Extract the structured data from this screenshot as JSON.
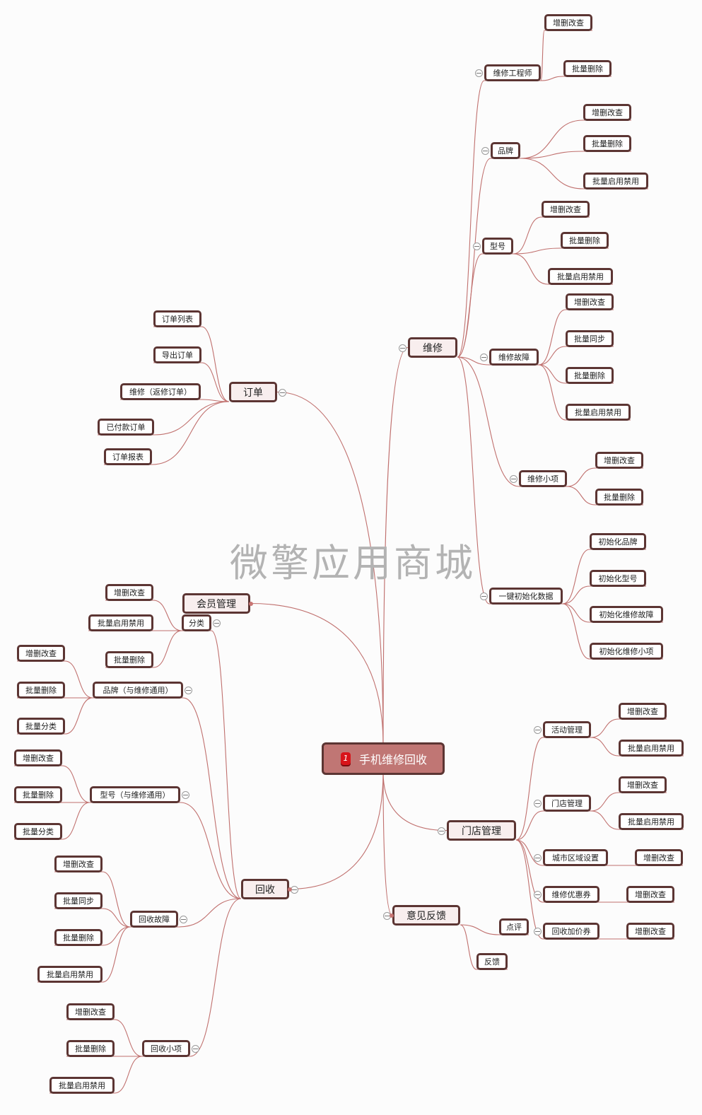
{
  "watermark": "微擎应用商城",
  "colors": {
    "link": "#c0706e",
    "border": "#5c3533",
    "root_fill": "#c07674",
    "l1_fill": "#f8eeee",
    "badge": "#d8141a"
  },
  "root": {
    "id": "root",
    "label": "手机维修回收",
    "badge": "1"
  },
  "nodes": [
    {
      "id": "weixiu",
      "label": "维修",
      "parent": "root",
      "level": 1
    },
    {
      "id": "wx_gcs",
      "label": "维修工程师",
      "parent": "weixiu",
      "level": 2
    },
    {
      "id": "wx_gcs_1",
      "label": "增删改查",
      "parent": "wx_gcs",
      "level": 3
    },
    {
      "id": "wx_gcs_2",
      "label": "批量删除",
      "parent": "wx_gcs",
      "level": 3
    },
    {
      "id": "wx_pp",
      "label": "品牌",
      "parent": "weixiu",
      "level": 2
    },
    {
      "id": "wx_pp_1",
      "label": "增删改查",
      "parent": "wx_pp",
      "level": 3
    },
    {
      "id": "wx_pp_2",
      "label": "批量删除",
      "parent": "wx_pp",
      "level": 3
    },
    {
      "id": "wx_pp_3",
      "label": "批量启用禁用",
      "parent": "wx_pp",
      "level": 3
    },
    {
      "id": "wx_xh",
      "label": "型号",
      "parent": "weixiu",
      "level": 2
    },
    {
      "id": "wx_xh_1",
      "label": "增删改查",
      "parent": "wx_xh",
      "level": 3
    },
    {
      "id": "wx_xh_2",
      "label": "批量删除",
      "parent": "wx_xh",
      "level": 3
    },
    {
      "id": "wx_xh_3",
      "label": "批量启用禁用",
      "parent": "wx_xh",
      "level": 3
    },
    {
      "id": "wx_gz",
      "label": "维修故障",
      "parent": "weixiu",
      "level": 2
    },
    {
      "id": "wx_gz_1",
      "label": "增删改查",
      "parent": "wx_gz",
      "level": 3
    },
    {
      "id": "wx_gz_2",
      "label": "批量同步",
      "parent": "wx_gz",
      "level": 3
    },
    {
      "id": "wx_gz_3",
      "label": "批量删除",
      "parent": "wx_gz",
      "level": 3
    },
    {
      "id": "wx_gz_4",
      "label": "批量启用禁用",
      "parent": "wx_gz",
      "level": 3
    },
    {
      "id": "wx_xx",
      "label": "维修小项",
      "parent": "weixiu",
      "level": 2
    },
    {
      "id": "wx_xx_1",
      "label": "增删改查",
      "parent": "wx_xx",
      "level": 3
    },
    {
      "id": "wx_xx_2",
      "label": "批量删除",
      "parent": "wx_xx",
      "level": 3
    },
    {
      "id": "wx_init",
      "label": "一键初始化数据",
      "parent": "weixiu",
      "level": 2
    },
    {
      "id": "wx_init_1",
      "label": "初始化品牌",
      "parent": "wx_init",
      "level": 3
    },
    {
      "id": "wx_init_2",
      "label": "初始化型号",
      "parent": "wx_init",
      "level": 3
    },
    {
      "id": "wx_init_3",
      "label": "初始化维修故障",
      "parent": "wx_init",
      "level": 3
    },
    {
      "id": "wx_init_4",
      "label": "初始化维修小项",
      "parent": "wx_init",
      "level": 3
    },
    {
      "id": "dingdan",
      "label": "订单",
      "parent": "root",
      "level": 1
    },
    {
      "id": "dd_1",
      "label": "订单列表",
      "parent": "dingdan",
      "level": 2
    },
    {
      "id": "dd_2",
      "label": "导出订单",
      "parent": "dingdan",
      "level": 2
    },
    {
      "id": "dd_3",
      "label": "维修（返修订单）",
      "parent": "dingdan",
      "level": 2
    },
    {
      "id": "dd_4",
      "label": "已付款订单",
      "parent": "dingdan",
      "level": 2
    },
    {
      "id": "dd_5",
      "label": "订单报表",
      "parent": "dingdan",
      "level": 2
    },
    {
      "id": "huiyuan",
      "label": "会员管理",
      "parent": "root",
      "level": 1
    },
    {
      "id": "huishou",
      "label": "回收",
      "parent": "root",
      "level": 1
    },
    {
      "id": "hs_fl",
      "label": "分类",
      "parent": "huishou",
      "level": 2
    },
    {
      "id": "hs_fl_1",
      "label": "增删改查",
      "parent": "hs_fl",
      "level": 3
    },
    {
      "id": "hs_fl_2",
      "label": "批量启用禁用",
      "parent": "hs_fl",
      "level": 3
    },
    {
      "id": "hs_fl_3",
      "label": "批量删除",
      "parent": "hs_fl",
      "level": 3
    },
    {
      "id": "hs_pp",
      "label": "品牌（与维修通用）",
      "parent": "huishou",
      "level": 2
    },
    {
      "id": "hs_pp_1",
      "label": "增删改查",
      "parent": "hs_pp",
      "level": 3
    },
    {
      "id": "hs_pp_2",
      "label": "批量删除",
      "parent": "hs_pp",
      "level": 3
    },
    {
      "id": "hs_pp_3",
      "label": "批量分类",
      "parent": "hs_pp",
      "level": 3
    },
    {
      "id": "hs_xh",
      "label": "型号（与维修通用）",
      "parent": "huishou",
      "level": 2
    },
    {
      "id": "hs_xh_1",
      "label": "增删改查",
      "parent": "hs_xh",
      "level": 3
    },
    {
      "id": "hs_xh_2",
      "label": "批量删除",
      "parent": "hs_xh",
      "level": 3
    },
    {
      "id": "hs_xh_3",
      "label": "批量分类",
      "parent": "hs_xh",
      "level": 3
    },
    {
      "id": "hs_gz",
      "label": "回收故障",
      "parent": "huishou",
      "level": 2
    },
    {
      "id": "hs_gz_1",
      "label": "增删改查",
      "parent": "hs_gz",
      "level": 3
    },
    {
      "id": "hs_gz_2",
      "label": "批量同步",
      "parent": "hs_gz",
      "level": 3
    },
    {
      "id": "hs_gz_3",
      "label": "批量删除",
      "parent": "hs_gz",
      "level": 3
    },
    {
      "id": "hs_gz_4",
      "label": "批量启用禁用",
      "parent": "hs_gz",
      "level": 3
    },
    {
      "id": "hs_xx",
      "label": "回收小项",
      "parent": "huishou",
      "level": 2
    },
    {
      "id": "hs_xx_1",
      "label": "增删改查",
      "parent": "hs_xx",
      "level": 3
    },
    {
      "id": "hs_xx_2",
      "label": "批量删除",
      "parent": "hs_xx",
      "level": 3
    },
    {
      "id": "hs_xx_3",
      "label": "批量启用禁用",
      "parent": "hs_xx",
      "level": 3
    },
    {
      "id": "mendian",
      "label": "门店管理",
      "parent": "root",
      "level": 1
    },
    {
      "id": "md_hd",
      "label": "活动管理",
      "parent": "mendian",
      "level": 2
    },
    {
      "id": "md_hd_1",
      "label": "增删改查",
      "parent": "md_hd",
      "level": 3
    },
    {
      "id": "md_hd_2",
      "label": "批量启用禁用",
      "parent": "md_hd",
      "level": 3
    },
    {
      "id": "md_md",
      "label": "门店管理",
      "parent": "mendian",
      "level": 2
    },
    {
      "id": "md_md_1",
      "label": "增删改查",
      "parent": "md_md",
      "level": 3
    },
    {
      "id": "md_md_2",
      "label": "批量启用禁用",
      "parent": "md_md",
      "level": 3
    },
    {
      "id": "md_qy",
      "label": "城市区域设置",
      "parent": "mendian",
      "level": 2
    },
    {
      "id": "md_qy_1",
      "label": "增删改查",
      "parent": "md_qy",
      "level": 3
    },
    {
      "id": "md_yh",
      "label": "维修优惠券",
      "parent": "mendian",
      "level": 2
    },
    {
      "id": "md_yh_1",
      "label": "增删改查",
      "parent": "md_yh",
      "level": 3
    },
    {
      "id": "md_jj",
      "label": "回收加价券",
      "parent": "mendian",
      "level": 2
    },
    {
      "id": "md_jj_1",
      "label": "增删改查",
      "parent": "md_jj",
      "level": 3
    },
    {
      "id": "yijian",
      "label": "意见反馈",
      "parent": "root",
      "level": 1
    },
    {
      "id": "yj_dp",
      "label": "点评",
      "parent": "yijian",
      "level": 2
    },
    {
      "id": "yj_fk",
      "label": "反馈",
      "parent": "yijian",
      "level": 2
    }
  ]
}
